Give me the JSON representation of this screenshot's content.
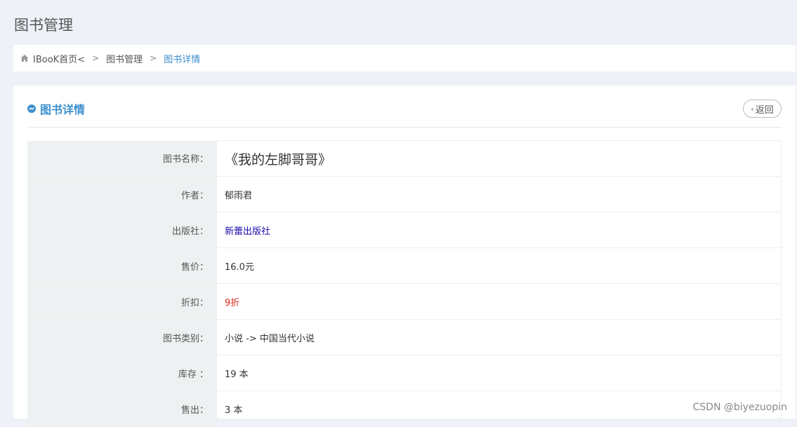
{
  "header": {
    "title": "图书管理"
  },
  "breadcrumb": {
    "home": "IBooK首页<",
    "section": "图书管理",
    "current": "图书详情"
  },
  "panel": {
    "title": "图书详情",
    "back_label": "返回"
  },
  "details": [
    {
      "label": "图书名称：",
      "value": "《我的左脚哥哥》"
    },
    {
      "label": "作者：",
      "value": "郁雨君"
    },
    {
      "label": "出版社：",
      "value": "新蕾出版社"
    },
    {
      "label": "售价：",
      "value": "16.0元"
    },
    {
      "label": "折扣：",
      "value": "9折"
    },
    {
      "label": "图书类别：",
      "value": "小说 -> 中国当代小说"
    },
    {
      "label": "库存 ：",
      "value": "19 本"
    },
    {
      "label": "售出：",
      "value": "3 本"
    }
  ],
  "watermark": "CSDN @biyezuopin",
  "colors": {
    "accent": "#3d8fce",
    "publisher": "#1a0dab",
    "discount": "#d62d20"
  }
}
